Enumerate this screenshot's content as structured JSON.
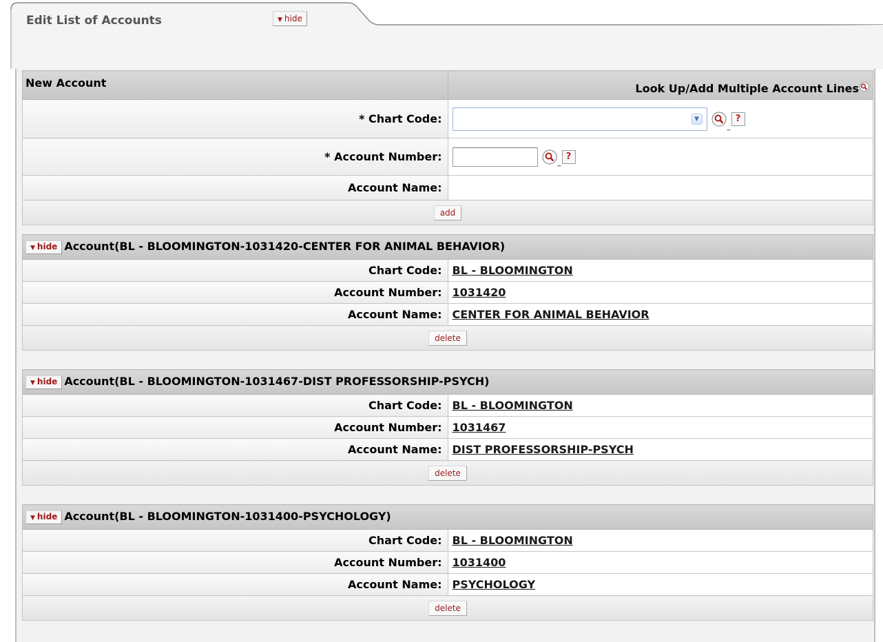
{
  "tab": {
    "title": "Edit List of Accounts",
    "hide_label": "hide"
  },
  "new_account": {
    "header": "New Account",
    "lookup_multiple_label": "Look Up/Add Multiple Account Lines",
    "fields": {
      "chart_code_label": "* Chart Code:",
      "account_number_label": "* Account Number:",
      "account_name_label": "Account Name:"
    },
    "add_label": "add"
  },
  "accounts": [
    {
      "hide_label": "hide",
      "header": "Account(BL - BLOOMINGTON-1031420-CENTER FOR ANIMAL BEHAVIOR)",
      "chart_code_label": "Chart Code:",
      "chart_code": "BL - BLOOMINGTON",
      "account_number_label": "Account Number:",
      "account_number": "1031420",
      "account_name_label": "Account Name:",
      "account_name": "CENTER FOR ANIMAL BEHAVIOR",
      "delete_label": "delete"
    },
    {
      "hide_label": "hide",
      "header": "Account(BL - BLOOMINGTON-1031467-DIST PROFESSORSHIP-PSYCH)",
      "chart_code_label": "Chart Code:",
      "chart_code": "BL - BLOOMINGTON",
      "account_number_label": "Account Number:",
      "account_number": "1031467",
      "account_name_label": "Account Name:",
      "account_name": "DIST PROFESSORSHIP-PSYCH",
      "delete_label": "delete"
    },
    {
      "hide_label": "hide",
      "header": "Account(BL - BLOOMINGTON-1031400-PSYCHOLOGY)",
      "chart_code_label": "Chart Code:",
      "chart_code": "BL - BLOOMINGTON",
      "account_number_label": "Account Number:",
      "account_number": "1031400",
      "account_name_label": "Account Name:",
      "account_name": "PSYCHOLOGY",
      "delete_label": "delete"
    }
  ],
  "icons": {
    "lookup": "magnifier-icon",
    "help": "help-icon",
    "hide_triangle": "triangle-down-icon"
  },
  "colors": {
    "button_text": "#a01818",
    "header_bg": "#c9c9c9",
    "label_bg": "#eeeeee"
  }
}
